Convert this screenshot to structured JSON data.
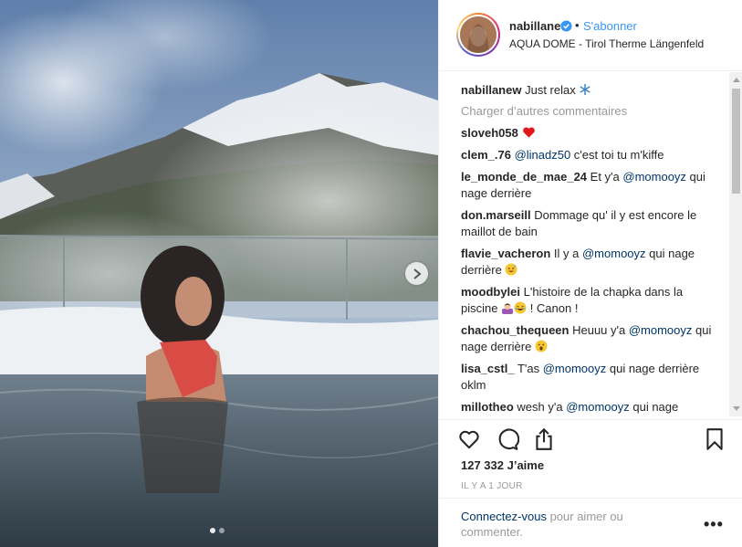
{
  "post": {
    "username": "nabillanew",
    "follow_label": "S'abonner",
    "separator": "•",
    "location": "AQUA DOME - Tirol Therme Längenfeld"
  },
  "caption": {
    "username": "nabillanew",
    "text": "Just relax "
  },
  "load_more": "Charger d’autres commentaires",
  "comments": [
    {
      "user": "sloveh058",
      "pre": "",
      "mention": "",
      "post": ""
    },
    {
      "user": "clem_.76",
      "pre": "",
      "mention": "@linadz50",
      "post": " c'est toi tu m'kiffe"
    },
    {
      "user": "le_monde_de_mae_24",
      "pre": "Et y'a ",
      "mention": "@momooyz",
      "post": " qui nage derrière"
    },
    {
      "user": "don.marseill",
      "pre": "Dommage qu' il y est encore le maillot de bain",
      "mention": "",
      "post": ""
    },
    {
      "user": "flavie_vacheron",
      "pre": "Il y a ",
      "mention": "@momooyz",
      "post": " qui nage derrière "
    },
    {
      "user": "moodbylei",
      "pre": "L'histoire de la chapka dans la piscine ",
      "mention": "",
      "post": " ! Canon !"
    },
    {
      "user": "chachou_thequeen",
      "pre": "Heuuu y'a ",
      "mention": "@momooyz",
      "post": " qui nage derrière "
    },
    {
      "user": "lisa_cstl_",
      "pre": "T'as ",
      "mention": "@momooyz",
      "post": " qui nage derrière oklm"
    },
    {
      "user": "millotheo",
      "pre": "wesh y'a ",
      "mention": "@momooyz",
      "post": " qui nage"
    }
  ],
  "likes": "127 332 J’aime",
  "time_ago": "IL Y A 1 JOUR",
  "login": {
    "link": "Connectez-vous",
    "rest": " pour aimer ou commenter."
  },
  "more_label": "•••",
  "icons": {
    "verified": "verified-badge-icon",
    "next": "chevron-right-icon",
    "like": "heart-icon",
    "comment": "comment-bubble-icon",
    "share": "share-icon",
    "save": "bookmark-icon",
    "snowflake": "snowflake-icon",
    "red_heart": "red-heart-emoji",
    "sweat_smile": "sweat-smile-emoji",
    "woman_gesturing": "woman-gesturing-emoji",
    "laugh": "grinning-sweat-emoji",
    "surprised": "surprised-emoji"
  },
  "colors": {
    "accent": "#3897f0",
    "mention": "#003569",
    "muted": "#999999"
  },
  "carousel": {
    "total": 2,
    "active": 1
  }
}
